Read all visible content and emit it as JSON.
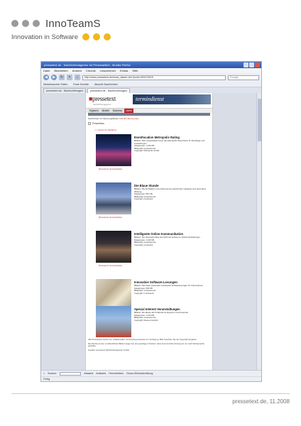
{
  "logo": {
    "brand": "InnoTeamS",
    "tagline": "Innovation in Software"
  },
  "browser": {
    "title": "pressetext.de - Nachrichtenagentur fur Presseartikel - Mozilla Firefox",
    "menu": [
      "Datei",
      "Bearbeiten",
      "Ansicht",
      "Chronik",
      "Lesezeichen",
      "Extras",
      "Hilfe"
    ],
    "url": "http://www.pressetext.de/news_attach.cfm?pmid=081123015",
    "search_placeholder": "Google",
    "bookmarks": [
      "Meistbesuchte Seiten",
      "Erste Schritte",
      "Aktuelle Nachrichten"
    ],
    "tabs": [
      "pressetext.de - Nachrichtenagen...",
      "pressetext.de - Nachrichtenagen..."
    ],
    "find_label": "Suchen:",
    "find_buttons": [
      "Abwarts",
      "Aufwarts",
      "Hervorheben",
      "Gross-/Kleinschreibung"
    ],
    "status": "Fertig"
  },
  "page": {
    "logo_text": "pressetext",
    "logo_sub": "nachrichtenagentur",
    "banner": "termindienst",
    "nav": [
      "Hightech",
      "Medien",
      "Business",
      "Leben"
    ],
    "ticker_lead": "Nachrichten fur Meinungsbildner",
    "ticker_red": "102.367 Abonnenten",
    "section_label": "Pressefotos",
    "back_link": "<< zuruck zur Meldung",
    "entries": [
      {
        "title": "Eventlocation Metropolis Rating",
        "lines": [
          "Bildtext: Das neugestaltete Foyer des Metropolis bietet Raum fur Empfange und Ausstellungen.",
          "Dateigrosse: 1.234 KB",
          "Bildquelle: pressetext.de",
          "Copyright: Metropolis GmbH"
        ],
        "caption": "[Pressefoto herunterladen]"
      },
      {
        "title": "Die Blaue Stunde",
        "lines": [
          "Bildtext: Die Architektur in der Dammerung verleiht dem Gebaude eine besondere Wirkung.",
          "Dateigrosse: 987 KB",
          "Bildquelle: pressetext.de",
          "Copyright: pressetext"
        ],
        "caption": "[Pressefoto herunterladen]"
      },
      {
        "title": "Intelligente Online Kommunikation",
        "lines": [
          "Bildtext: Der historische Bau bei Nacht als Kulisse fur Fachveranstaltungen.",
          "Dateigrosse: 1.102 KB",
          "Bildquelle: pressetext.de",
          "Copyright: pressetext"
        ],
        "caption": "[Pressefoto herunterladen]"
      },
      {
        "title": "Innovative Software-Losungen",
        "lines": [
          "Bildtext: Das Team prasentiert individuelle Softwarelosungen fur Unternehmen.",
          "Dateigrosse: 845 KB",
          "Bildquelle: pressetext.de",
          "Copyright: InnoTeamS"
        ],
        "caption": "[Pressefoto herunterladen]"
      },
      {
        "title": "Special Interest Veranstaltungen",
        "lines": [
          "Bildtext: Die Messe als Treffpunkt fur Experten und Anwender.",
          "Dateigrosse: 1.310 KB",
          "Bildquelle: pressetext.de",
          "Copyright: Messe Frankfurt"
        ],
        "caption": ""
      }
    ],
    "footer_paras": [
      "Alle Pressefotos stehen zur redaktionellen Verwendung kostenlos zur Verfugung. Bitte beachten Sie die Copyright-Angaben.",
      "Die Rechte an den veroffentlichten Bildern liegen bei den jeweiligen Urhebern. Eine kommerzielle Nutzung ist nur nach Rucksprache gestattet.",
      "Kontakt: pressetext Nachrichtenagentur GmbH"
    ]
  },
  "footer": {
    "source": "pressetext.de, 11.2008"
  }
}
